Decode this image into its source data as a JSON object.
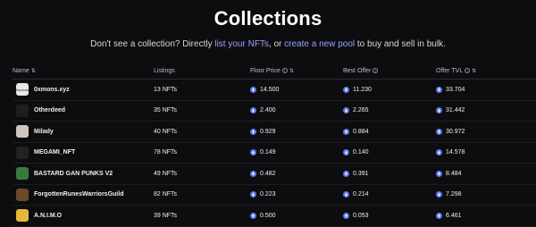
{
  "page": {
    "title": "Collections",
    "subtitle_prefix": "Don't see a collection? Directly ",
    "subtitle_link1": "list your NFTs",
    "subtitle_middle": ", or ",
    "subtitle_link2": "create a new pool",
    "subtitle_suffix": " to buy and sell in bulk."
  },
  "table": {
    "headers": {
      "name": "Name",
      "listings": "Listings",
      "floor_price": "Floor Price",
      "best_offer": "Best Offer",
      "offer_tvl": "Offer TVL"
    },
    "rows": [
      {
        "name": "0xmons.xyz",
        "listings": "13 NFTs",
        "floor": "14.500",
        "offer": "11.230",
        "tvl": "33.704",
        "avatar_color": "#e8e8e8",
        "avatar_text": "0xmons"
      },
      {
        "name": "Otherdeed",
        "listings": "35 NFTs",
        "floor": "2.400",
        "offer": "2.265",
        "tvl": "31.442",
        "avatar_color": "#1e1e1e",
        "avatar_text": ""
      },
      {
        "name": "Milady",
        "listings": "40 NFTs",
        "floor": "0.929",
        "offer": "0.884",
        "tvl": "30.972",
        "avatar_color": "#cfc6bd",
        "avatar_text": ""
      },
      {
        "name": "MEGAMI_NFT",
        "listings": "78 NFTs",
        "floor": "0.149",
        "offer": "0.140",
        "tvl": "14.578",
        "avatar_color": "#222222",
        "avatar_text": ""
      },
      {
        "name": "BASTARD GAN PUNKS V2",
        "listings": "49 NFTs",
        "floor": "0.482",
        "offer": "0.391",
        "tvl": "8.484",
        "avatar_color": "#3c7a3c",
        "avatar_text": ""
      },
      {
        "name": "ForgottenRunesWarriorsGuild",
        "listings": "82 NFTs",
        "floor": "0.223",
        "offer": "0.214",
        "tvl": "7.298",
        "avatar_color": "#6b4a2b",
        "avatar_text": ""
      },
      {
        "name": "A.N.I.M.O",
        "listings": "39 NFTs",
        "floor": "0.500",
        "offer": "0.053",
        "tvl": "6.461",
        "avatar_color": "#e2b93b",
        "avatar_text": ""
      }
    ]
  },
  "colors": {
    "background": "#0d0d0f",
    "link": "#9aa0ff",
    "eth_icon": "#5b78e8"
  }
}
